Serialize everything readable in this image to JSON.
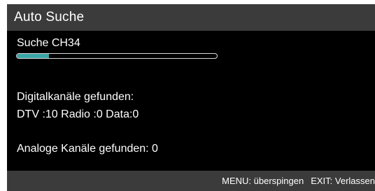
{
  "header": {
    "title": "Auto Suche"
  },
  "scan": {
    "channel_label": "Suche CH34",
    "progress_percent": 16
  },
  "results": {
    "digital_title": "Digitalkanäle gefunden:",
    "digital_counts": "DTV :10 Radio :0 Data:0",
    "analog_line": "Analoge Kanäle gefunden: 0"
  },
  "footer": {
    "menu_hint": "MENU: überspingen",
    "exit_hint": "EXIT: Verlassen"
  },
  "colors": {
    "background": "#000000",
    "bar": "#3b3b3b",
    "progress_fill": "#3aa6a6",
    "text": "#ffffff"
  }
}
